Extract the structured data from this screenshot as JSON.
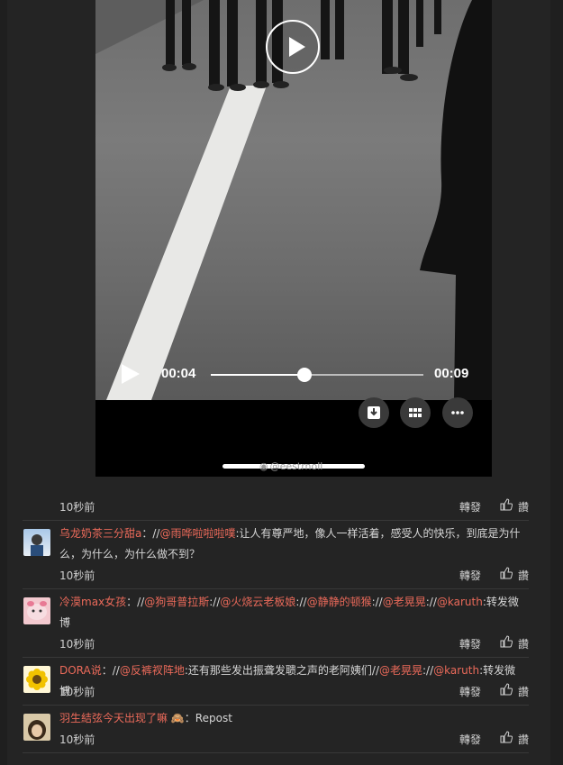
{
  "video": {
    "current_time": "00:04",
    "duration": "00:09",
    "progress": 0.44,
    "watermark": "@eestrnoll"
  },
  "post": {
    "time": "10秒前",
    "forward": "轉發",
    "like": "讚"
  },
  "comments": [
    {
      "user": "乌龙奶茶三分甜a",
      "sep1": "：//",
      "mention1": "@雨哗啦啦啦噗",
      "text": ":让人有尊严地，像人一样活着，感受人的快乐，到底是为什么，为什么，为什么做不到？",
      "time": "10秒前",
      "forward": "轉發",
      "like": "讚"
    },
    {
      "user": "冷漠max女孩",
      "sep1": "：//",
      "mention1": "@狗哥普拉斯",
      "sep2": "://",
      "mention2": "@火烧云老板娘",
      "sep3": "://",
      "mention3": "@静静的顿猴",
      "sep4": "://",
      "mention4": "@老晃晃",
      "sep5": "://",
      "mention5": "@karuth",
      "text": ":转发微博",
      "time": "10秒前",
      "forward": "轉發",
      "like": "讚"
    },
    {
      "user": "DORA说",
      "sep1": "：//",
      "mention1": "@反裤衩阵地",
      "text1": ":还有那些发出振聋发聩之声的老阿姨们//",
      "mention2": "@老晃晃",
      "sep2": "://",
      "mention3": "@karuth",
      "text2": ":转发微博",
      "time": "10秒前",
      "forward": "轉發",
      "like": "讚"
    },
    {
      "user": "羽生結弦今天出现了嘛",
      "emoji": "🙈",
      "text": "：Repost",
      "time": "10秒前",
      "forward": "轉發",
      "like": "讚"
    }
  ],
  "colors": {
    "bg": "#1f1f1f",
    "card": "#242424",
    "username": "#eb6a5a",
    "text": "#d6d6d6"
  },
  "icons": [
    "play-icon",
    "download-icon",
    "grid-icon",
    "more-icon",
    "like-icon",
    "weibo-logo-icon"
  ]
}
